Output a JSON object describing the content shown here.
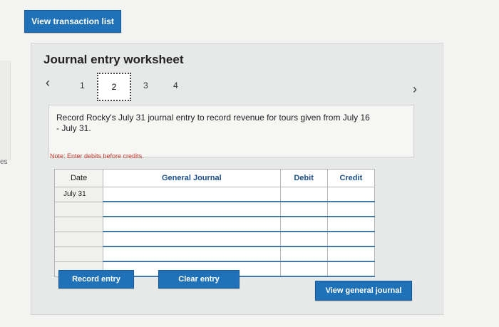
{
  "buttons": {
    "view_transaction_list": "View transaction list",
    "record_entry": "Record entry",
    "clear_entry": "Clear entry",
    "view_general_journal": "View general journal"
  },
  "side_text": "es",
  "worksheet": {
    "title": "Journal entry worksheet",
    "steps": [
      "1",
      "2",
      "3",
      "4"
    ],
    "current_step": "2",
    "instruction": "Record Rocky's July 31 journal entry to record revenue for tours given from July 16 - July 31.",
    "note": "Note: Enter debits before credits."
  },
  "table": {
    "headers": {
      "date": "Date",
      "general_journal": "General Journal",
      "debit": "Debit",
      "credit": "Credit"
    },
    "first_date": "July 31"
  },
  "colors": {
    "accent": "#1f72b8",
    "note": "#c0392b"
  },
  "icons": {
    "prev": "chevron-left-icon",
    "next": "chevron-right-icon"
  }
}
